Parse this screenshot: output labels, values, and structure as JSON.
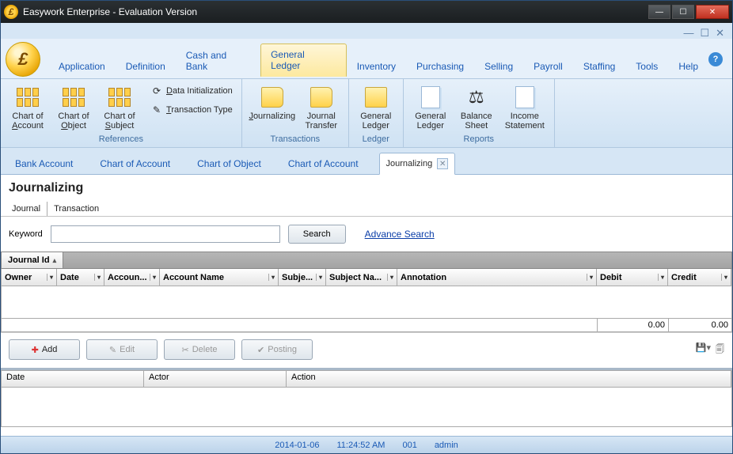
{
  "window": {
    "title": "Easywork Enterprise - Evaluation Version"
  },
  "menu": {
    "items": [
      "Application",
      "Definition",
      "Cash and Bank",
      "General Ledger",
      "Inventory",
      "Purchasing",
      "Selling",
      "Payroll",
      "Staffing",
      "Tools",
      "Help"
    ],
    "active_index": 3
  },
  "ribbon": {
    "references": {
      "title": "References",
      "chart_account": "Chart of Account",
      "chart_object": "Chart of Object",
      "chart_subject": "Chart of Subject",
      "data_init": "Data Initialization",
      "trans_type": "Transaction Type"
    },
    "transactions": {
      "title": "Transactions",
      "journalizing": "Journalizing",
      "journal_transfer": "Journal Transfer"
    },
    "ledger": {
      "title": "Ledger",
      "general_ledger": "General Ledger"
    },
    "reports": {
      "title": "Reports",
      "general_ledger": "General Ledger",
      "balance_sheet": "Balance Sheet",
      "income_statement": "Income Statement"
    }
  },
  "doc_tabs": {
    "items": [
      "Bank Account",
      "Chart of Account",
      "Chart of Object",
      "Chart of Account",
      "Journalizing"
    ],
    "active_index": 4
  },
  "page": {
    "title": "Journalizing",
    "sub_tabs": [
      "Journal",
      "Transaction"
    ],
    "keyword_label": "Keyword",
    "search_btn": "Search",
    "advance_link": "Advance Search",
    "group_by": "Journal Id",
    "columns": [
      "Owner",
      "Date",
      "Accoun...",
      "Account Name",
      "Subje...",
      "Subject Na...",
      "Annotation",
      "Debit",
      "Credit"
    ],
    "totals": {
      "debit": "0.00",
      "credit": "0.00"
    },
    "buttons": {
      "add": "Add",
      "edit": "Edit",
      "delete": "Delete",
      "posting": "Posting"
    },
    "log_columns": [
      "Date",
      "Actor",
      "Action"
    ]
  },
  "status": {
    "date": "2014-01-06",
    "time": "11:24:52 AM",
    "code": "001",
    "user": "admin"
  }
}
